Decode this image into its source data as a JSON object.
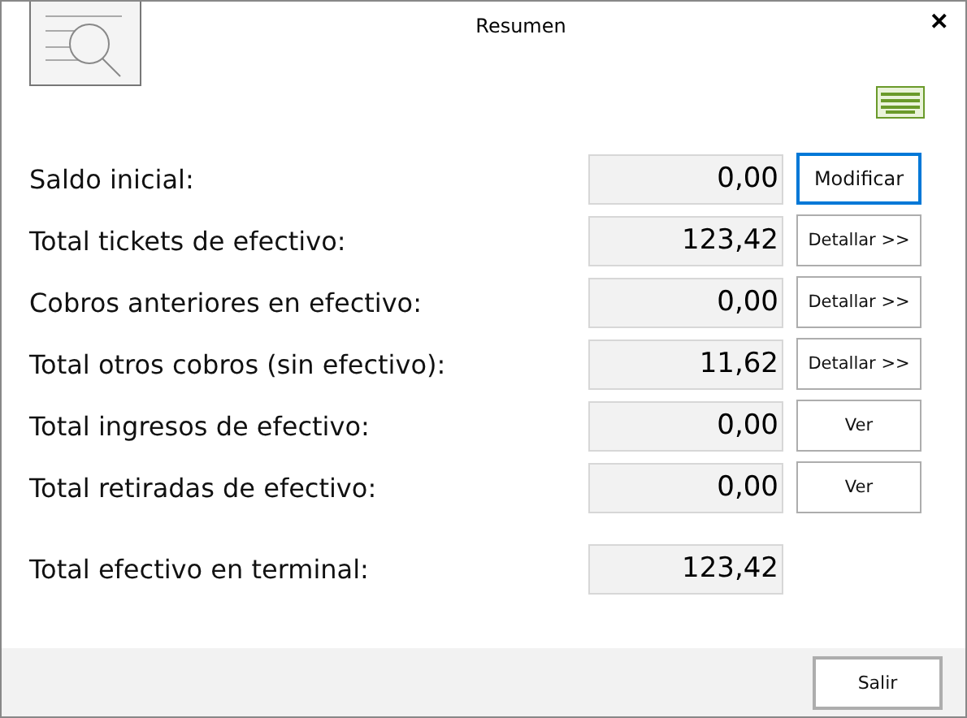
{
  "window": {
    "title": "Resumen",
    "close": "✕"
  },
  "rows": [
    {
      "label": "Saldo inicial:",
      "value": "0,00",
      "button": {
        "label": "Modificar",
        "focused": true
      }
    },
    {
      "label": "Total tickets de efectivo:",
      "value": "123,42",
      "button": {
        "label": "Detallar >>",
        "focused": false
      }
    },
    {
      "label": "Cobros anteriores en efectivo:",
      "value": "0,00",
      "button": {
        "label": "Detallar >>",
        "focused": false
      }
    },
    {
      "label": "Total otros cobros (sin efectivo):",
      "value": "11,62",
      "button": {
        "label": "Detallar >>",
        "focused": false
      }
    },
    {
      "label": "Total ingresos de efectivo:",
      "value": "0,00",
      "button": {
        "label": "Ver",
        "focused": false
      }
    },
    {
      "label": "Total retiradas de efectivo:",
      "value": "0,00",
      "button": {
        "label": "Ver",
        "focused": false
      }
    }
  ],
  "total": {
    "label": "Total efectivo en terminal:",
    "value": "123,42"
  },
  "footer": {
    "button": "Salir"
  }
}
